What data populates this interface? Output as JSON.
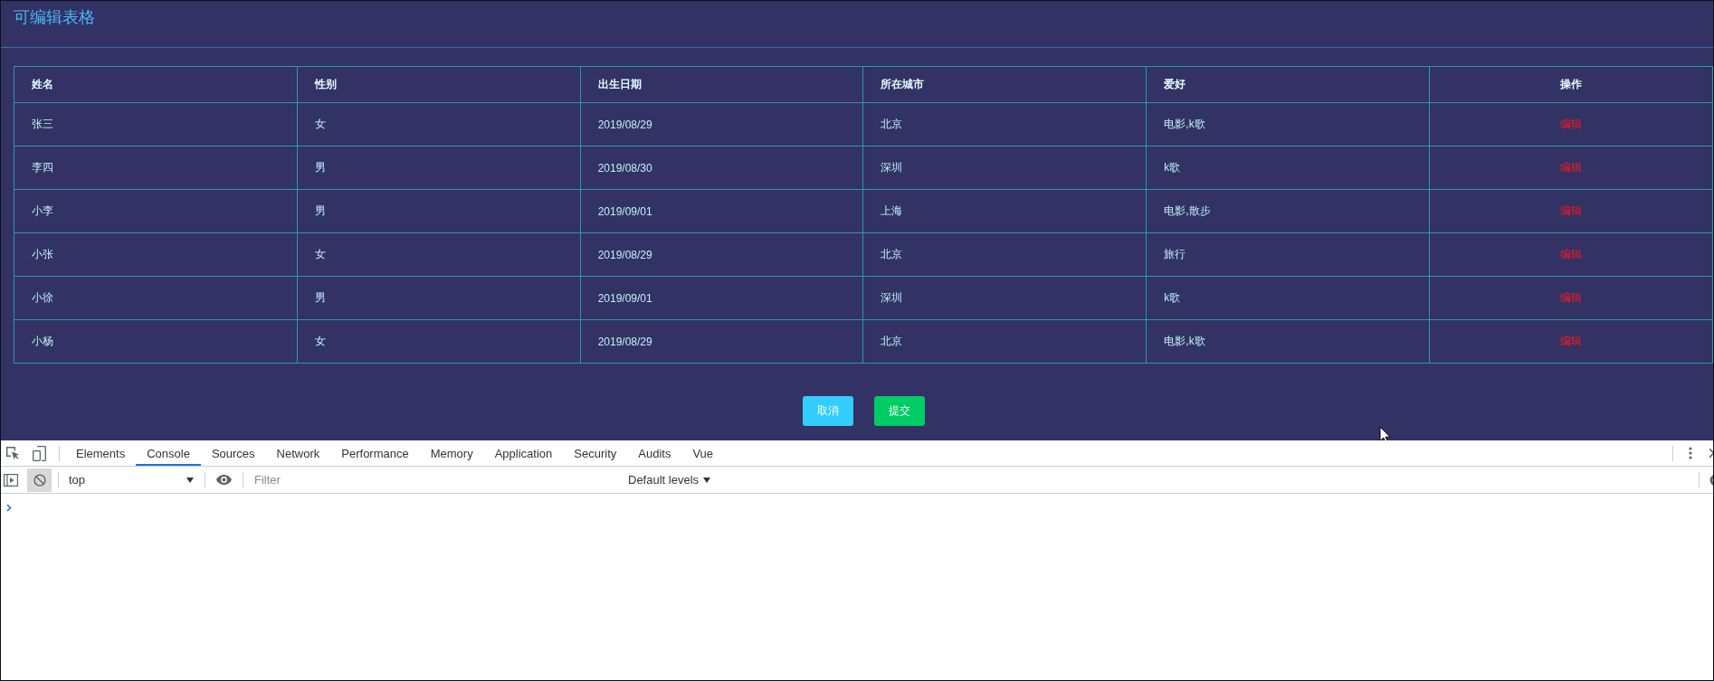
{
  "page": {
    "title": "可编辑表格"
  },
  "table": {
    "columns": [
      {
        "label": "姓名",
        "kind": "text"
      },
      {
        "label": "性别",
        "kind": "text"
      },
      {
        "label": "出生日期",
        "kind": "text"
      },
      {
        "label": "所在城市",
        "kind": "text"
      },
      {
        "label": "爱好",
        "kind": "text"
      },
      {
        "label": "操作",
        "kind": "action"
      }
    ],
    "rows": [
      {
        "cells": [
          "张三",
          "女",
          "2019/08/29",
          "北京",
          "电影,k歌",
          "编辑"
        ]
      },
      {
        "cells": [
          "李四",
          "男",
          "2019/08/30",
          "深圳",
          "k歌",
          "编辑"
        ]
      },
      {
        "cells": [
          "小李",
          "男",
          "2019/09/01",
          "上海",
          "电影,散步",
          "编辑"
        ]
      },
      {
        "cells": [
          "小张",
          "女",
          "2019/08/29",
          "北京",
          "旅行",
          "编辑"
        ]
      },
      {
        "cells": [
          "小徐",
          "男",
          "2019/09/01",
          "深圳",
          "k歌",
          "编辑"
        ]
      },
      {
        "cells": [
          "小杨",
          "女",
          "2019/08/29",
          "北京",
          "电影,k歌",
          "编辑"
        ]
      }
    ]
  },
  "buttons": [
    {
      "label": "取消",
      "kind": "cancel"
    },
    {
      "label": "提交",
      "kind": "submit"
    }
  ],
  "devtools": {
    "tabs": [
      {
        "label": "Elements",
        "selected": false
      },
      {
        "label": "Console",
        "selected": true
      },
      {
        "label": "Sources",
        "selected": false
      },
      {
        "label": "Network",
        "selected": false
      },
      {
        "label": "Performance",
        "selected": false
      },
      {
        "label": "Memory",
        "selected": false
      },
      {
        "label": "Application",
        "selected": false
      },
      {
        "label": "Security",
        "selected": false
      },
      {
        "label": "Audits",
        "selected": false
      },
      {
        "label": "Vue",
        "selected": false
      }
    ],
    "console_toolbar": {
      "clear_pressed": true,
      "context": "top",
      "filter_placeholder": "Filter",
      "levels": "Default levels"
    }
  }
}
